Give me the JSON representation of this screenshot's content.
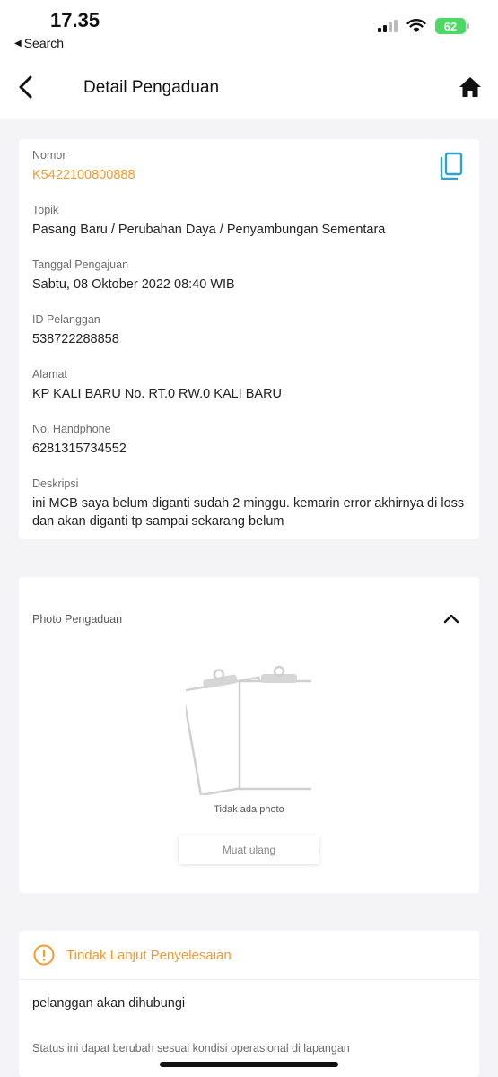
{
  "status_bar": {
    "time": "17.35",
    "back_app": "Search",
    "battery": "62"
  },
  "header": {
    "title": "Detail Pengaduan"
  },
  "details": [
    {
      "label": "Nomor",
      "value": "K542210080088 8"
    },
    {
      "label": "Topik",
      "value": "Pasang Baru / Perubahan Daya / Penyambungan Sementara"
    },
    {
      "label": "Tanggal Pengajuan",
      "value": "Sabtu, 08 Oktober 2022 08:40 WIB"
    },
    {
      "label": "ID Pelanggan",
      "value": "538722288858"
    },
    {
      "label": "Alamat",
      "value": "KP KALI BARU No. RT.0 RW.0 KALI BARU"
    },
    {
      "label": "No. Handphone",
      "value": "6281315734552"
    },
    {
      "label": "Deskripsi",
      "value": "ini MCB saya belum diganti sudah 2 minggu. kemarin error akhirnya di loss dan akan diganti tp sampai sekarang belum"
    }
  ],
  "photo": {
    "title": "Photo Pengaduan",
    "empty_text": "Tidak ada photo",
    "reload_label": "Muat ulang"
  },
  "followup": {
    "title": "Tindak Lanjut Penyelesaian",
    "text": "pelanggan akan dihubungi",
    "note": "Status ini dapat berubah sesuai kondisi operasional di lapangan"
  },
  "colors": {
    "accent": "#f29b2e",
    "copy_icon": "#2ea2c9",
    "battery": "#4cd964"
  },
  "icons": {
    "back": "chevron-left-icon",
    "home": "home-icon",
    "copy": "copy-icon",
    "collapse": "chevron-up-icon",
    "empty": "clipboard-icon",
    "warning": "exclamation-circle-icon"
  }
}
